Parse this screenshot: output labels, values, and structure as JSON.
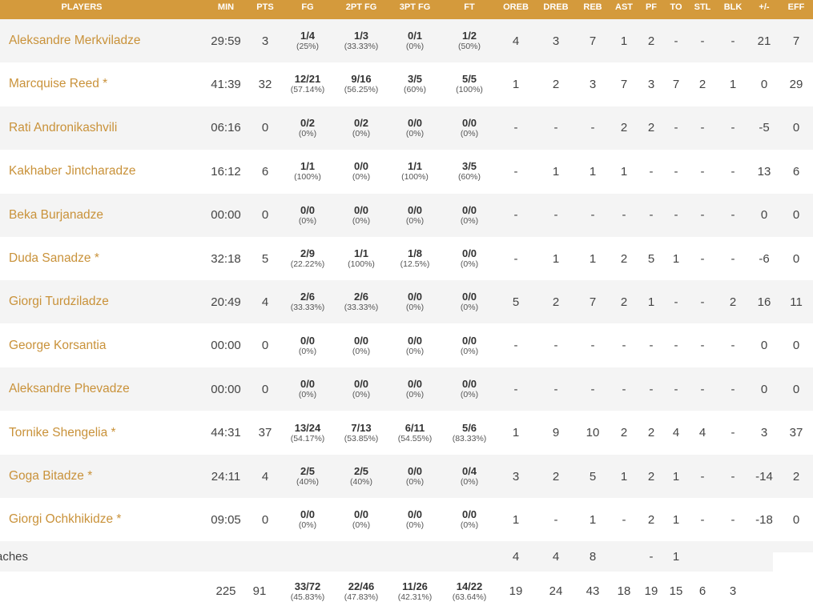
{
  "columns": {
    "players": "PLAYERS",
    "min": "MIN",
    "pts": "PTS",
    "fg": "FG",
    "fg2": "2PT FG",
    "fg3": "3PT FG",
    "ft": "FT",
    "oreb": "OREB",
    "dreb": "DREB",
    "reb": "REB",
    "ast": "AST",
    "pf": "PF",
    "to": "TO",
    "stl": "STL",
    "blk": "BLK",
    "pm": "+/-",
    "eff": "EFF"
  },
  "players": [
    {
      "name": "Aleksandre Merkviladze",
      "min": "29:59",
      "pts": "3",
      "fg": "1/4",
      "fg_pct": "(25%)",
      "fg2": "1/3",
      "fg2_pct": "(33.33%)",
      "fg3": "0/1",
      "fg3_pct": "(0%)",
      "ft": "1/2",
      "ft_pct": "(50%)",
      "oreb": "4",
      "dreb": "3",
      "reb": "7",
      "ast": "1",
      "pf": "2",
      "to": "-",
      "stl": "-",
      "blk": "-",
      "pm": "21",
      "eff": "7"
    },
    {
      "name": "Marcquise Reed *",
      "min": "41:39",
      "pts": "32",
      "fg": "12/21",
      "fg_pct": "(57.14%)",
      "fg2": "9/16",
      "fg2_pct": "(56.25%)",
      "fg3": "3/5",
      "fg3_pct": "(60%)",
      "ft": "5/5",
      "ft_pct": "(100%)",
      "oreb": "1",
      "dreb": "2",
      "reb": "3",
      "ast": "7",
      "pf": "3",
      "to": "7",
      "stl": "2",
      "blk": "1",
      "pm": "0",
      "eff": "29"
    },
    {
      "name": "Rati Andronikashvili",
      "min": "06:16",
      "pts": "0",
      "fg": "0/2",
      "fg_pct": "(0%)",
      "fg2": "0/2",
      "fg2_pct": "(0%)",
      "fg3": "0/0",
      "fg3_pct": "(0%)",
      "ft": "0/0",
      "ft_pct": "(0%)",
      "oreb": "-",
      "dreb": "-",
      "reb": "-",
      "ast": "2",
      "pf": "2",
      "to": "-",
      "stl": "-",
      "blk": "-",
      "pm": "-5",
      "eff": "0"
    },
    {
      "name": "Kakhaber Jintcharadze",
      "min": "16:12",
      "pts": "6",
      "fg": "1/1",
      "fg_pct": "(100%)",
      "fg2": "0/0",
      "fg2_pct": "(0%)",
      "fg3": "1/1",
      "fg3_pct": "(100%)",
      "ft": "3/5",
      "ft_pct": "(60%)",
      "oreb": "-",
      "dreb": "1",
      "reb": "1",
      "ast": "1",
      "pf": "-",
      "to": "-",
      "stl": "-",
      "blk": "-",
      "pm": "13",
      "eff": "6"
    },
    {
      "name": "Beka Burjanadze",
      "min": "00:00",
      "pts": "0",
      "fg": "0/0",
      "fg_pct": "(0%)",
      "fg2": "0/0",
      "fg2_pct": "(0%)",
      "fg3": "0/0",
      "fg3_pct": "(0%)",
      "ft": "0/0",
      "ft_pct": "(0%)",
      "oreb": "-",
      "dreb": "-",
      "reb": "-",
      "ast": "-",
      "pf": "-",
      "to": "-",
      "stl": "-",
      "blk": "-",
      "pm": "0",
      "eff": "0"
    },
    {
      "name": "Duda Sanadze *",
      "min": "32:18",
      "pts": "5",
      "fg": "2/9",
      "fg_pct": "(22.22%)",
      "fg2": "1/1",
      "fg2_pct": "(100%)",
      "fg3": "1/8",
      "fg3_pct": "(12.5%)",
      "ft": "0/0",
      "ft_pct": "(0%)",
      "oreb": "-",
      "dreb": "1",
      "reb": "1",
      "ast": "2",
      "pf": "5",
      "to": "1",
      "stl": "-",
      "blk": "-",
      "pm": "-6",
      "eff": "0"
    },
    {
      "name": "Giorgi Turdziladze",
      "min": "20:49",
      "pts": "4",
      "fg": "2/6",
      "fg_pct": "(33.33%)",
      "fg2": "2/6",
      "fg2_pct": "(33.33%)",
      "fg3": "0/0",
      "fg3_pct": "(0%)",
      "ft": "0/0",
      "ft_pct": "(0%)",
      "oreb": "5",
      "dreb": "2",
      "reb": "7",
      "ast": "2",
      "pf": "1",
      "to": "-",
      "stl": "-",
      "blk": "2",
      "pm": "16",
      "eff": "11"
    },
    {
      "name": "George Korsantia",
      "min": "00:00",
      "pts": "0",
      "fg": "0/0",
      "fg_pct": "(0%)",
      "fg2": "0/0",
      "fg2_pct": "(0%)",
      "fg3": "0/0",
      "fg3_pct": "(0%)",
      "ft": "0/0",
      "ft_pct": "(0%)",
      "oreb": "-",
      "dreb": "-",
      "reb": "-",
      "ast": "-",
      "pf": "-",
      "to": "-",
      "stl": "-",
      "blk": "-",
      "pm": "0",
      "eff": "0"
    },
    {
      "name": "Aleksandre Phevadze",
      "min": "00:00",
      "pts": "0",
      "fg": "0/0",
      "fg_pct": "(0%)",
      "fg2": "0/0",
      "fg2_pct": "(0%)",
      "fg3": "0/0",
      "fg3_pct": "(0%)",
      "ft": "0/0",
      "ft_pct": "(0%)",
      "oreb": "-",
      "dreb": "-",
      "reb": "-",
      "ast": "-",
      "pf": "-",
      "to": "-",
      "stl": "-",
      "blk": "-",
      "pm": "0",
      "eff": "0"
    },
    {
      "name": "Tornike Shengelia *",
      "min": "44:31",
      "pts": "37",
      "fg": "13/24",
      "fg_pct": "(54.17%)",
      "fg2": "7/13",
      "fg2_pct": "(53.85%)",
      "fg3": "6/11",
      "fg3_pct": "(54.55%)",
      "ft": "5/6",
      "ft_pct": "(83.33%)",
      "oreb": "1",
      "dreb": "9",
      "reb": "10",
      "ast": "2",
      "pf": "2",
      "to": "4",
      "stl": "4",
      "blk": "-",
      "pm": "3",
      "eff": "37"
    },
    {
      "name": "Goga Bitadze *",
      "min": "24:11",
      "pts": "4",
      "fg": "2/5",
      "fg_pct": "(40%)",
      "fg2": "2/5",
      "fg2_pct": "(40%)",
      "fg3": "0/0",
      "fg3_pct": "(0%)",
      "ft": "0/4",
      "ft_pct": "(0%)",
      "oreb": "3",
      "dreb": "2",
      "reb": "5",
      "ast": "1",
      "pf": "2",
      "to": "1",
      "stl": "-",
      "blk": "-",
      "pm": "-14",
      "eff": "2"
    },
    {
      "name": "Giorgi Ochkhikidze *",
      "min": "09:05",
      "pts": "0",
      "fg": "0/0",
      "fg_pct": "(0%)",
      "fg2": "0/0",
      "fg2_pct": "(0%)",
      "fg3": "0/0",
      "fg3_pct": "(0%)",
      "ft": "0/0",
      "ft_pct": "(0%)",
      "oreb": "1",
      "dreb": "-",
      "reb": "1",
      "ast": "-",
      "pf": "2",
      "to": "1",
      "stl": "-",
      "blk": "-",
      "pm": "-18",
      "eff": "0"
    }
  ],
  "team_row": {
    "label": "aches",
    "oreb": "4",
    "dreb": "4",
    "reb": "8",
    "pf": "-",
    "to": "1"
  },
  "totals": {
    "min": "225",
    "pts": "91",
    "fg": "33/72",
    "fg_pct": "(45.83%)",
    "fg2": "22/46",
    "fg2_pct": "(47.83%)",
    "fg3": "11/26",
    "fg3_pct": "(42.31%)",
    "ft": "14/22",
    "ft_pct": "(63.64%)",
    "oreb": "19",
    "dreb": "24",
    "reb": "43",
    "ast": "18",
    "pf": "19",
    "to": "15",
    "stl": "6",
    "blk": "3"
  }
}
